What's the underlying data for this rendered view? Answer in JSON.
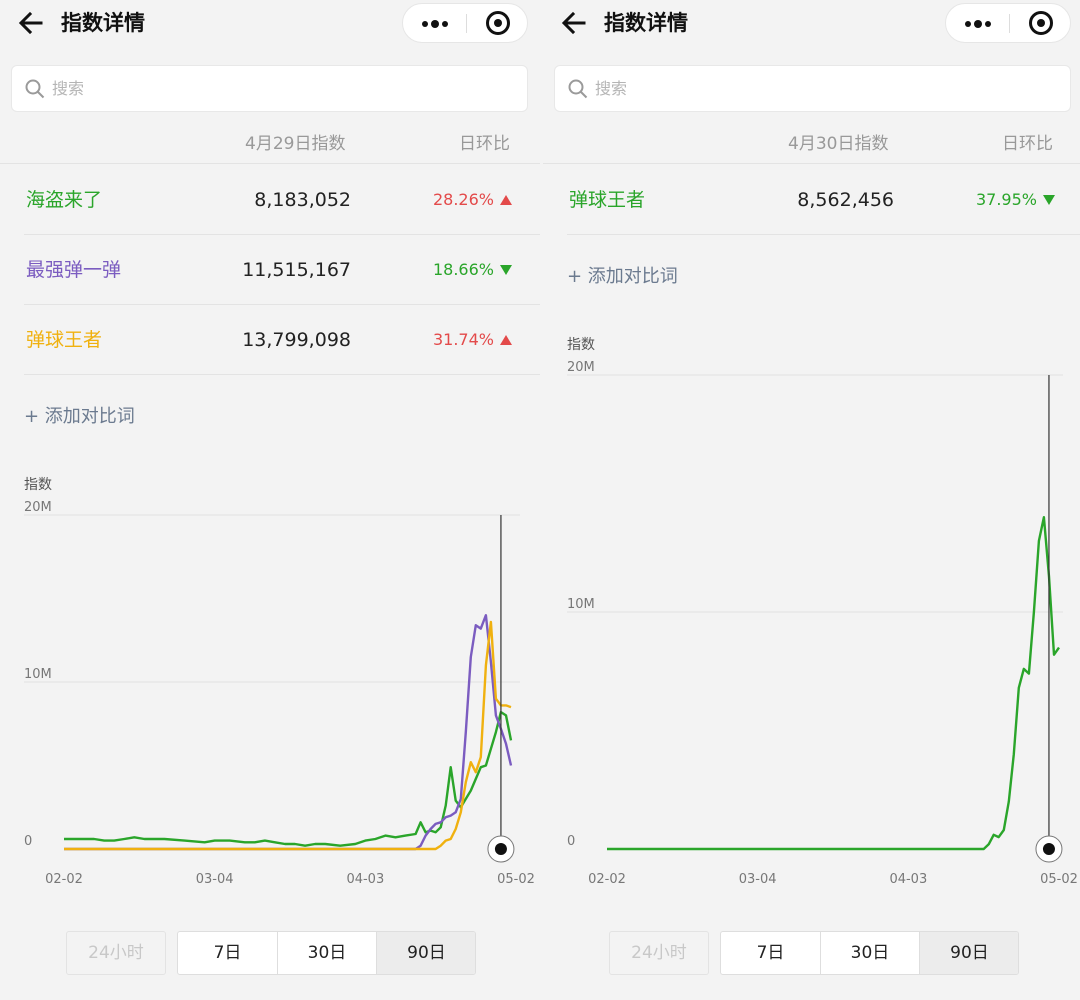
{
  "colors": {
    "green": "#2aa52a",
    "purple": "#7b5cc0",
    "orange": "#f0b10f",
    "up_red": "#e34a4a",
    "down_green": "#2aa52a",
    "grid": "#e2e2e2",
    "axis_text": "#777777"
  },
  "icons": [
    "arrow-left-icon",
    "more-dots-icon",
    "target-icon",
    "search-icon",
    "triangle-up-icon",
    "triangle-down-icon"
  ],
  "panels": [
    {
      "nav": {
        "title": "指数详情"
      },
      "search": {
        "placeholder": "搜索"
      },
      "table": {
        "date_header": "4月29日指数",
        "ratio_header": "日环比",
        "rows": [
          {
            "name": "海盗来了",
            "value": "8,183,052",
            "change": "28.26%",
            "direction": "up",
            "color": "#2aa52a"
          },
          {
            "name": "最强弹一弹",
            "value": "11,515,167",
            "change": "18.66%",
            "direction": "down",
            "color": "#7b5cc0"
          },
          {
            "name": "弹球王者",
            "value": "13,799,098",
            "change": "31.74%",
            "direction": "up",
            "color": "#f0b10f"
          }
        ]
      },
      "add_compare": "+ 添加对比词",
      "range_buttons": {
        "h24": "24小时",
        "d7": "7日",
        "d30": "30日",
        "d90": "90日",
        "selected": "90日",
        "h24_disabled": true
      }
    },
    {
      "nav": {
        "title": "指数详情"
      },
      "search": {
        "placeholder": "搜索"
      },
      "table": {
        "date_header": "4月30日指数",
        "ratio_header": "日环比",
        "rows": [
          {
            "name": "弹球王者",
            "value": "8,562,456",
            "change": "37.95%",
            "direction": "down",
            "color": "#2aa52a"
          }
        ]
      },
      "add_compare": "+ 添加对比词",
      "range_buttons": {
        "h24": "24小时",
        "d7": "7日",
        "d30": "30日",
        "d90": "90日",
        "selected": "90日",
        "h24_disabled": true
      }
    }
  ],
  "chart_data": [
    {
      "type": "line",
      "ylabel": "指数",
      "y_ticks": [
        "20M",
        "10M",
        "0"
      ],
      "ylim": [
        0,
        20000000
      ],
      "x_ticks": [
        "02-02",
        "03-04",
        "04-03",
        "05-02"
      ],
      "x_range_days": [
        0,
        90
      ],
      "cursor_day": 87,
      "grid": true,
      "series": [
        {
          "name": "海盗来了",
          "color": "#2aa52a",
          "points": [
            [
              0,
              0.6
            ],
            [
              6,
              0.6
            ],
            [
              8,
              0.5
            ],
            [
              10,
              0.5
            ],
            [
              12,
              0.6
            ],
            [
              14,
              0.7
            ],
            [
              16,
              0.6
            ],
            [
              20,
              0.6
            ],
            [
              24,
              0.5
            ],
            [
              28,
              0.4
            ],
            [
              30,
              0.5
            ],
            [
              33,
              0.5
            ],
            [
              36,
              0.4
            ],
            [
              38,
              0.4
            ],
            [
              40,
              0.5
            ],
            [
              42,
              0.4
            ],
            [
              44,
              0.3
            ],
            [
              46,
              0.3
            ],
            [
              48,
              0.2
            ],
            [
              50,
              0.3
            ],
            [
              52,
              0.3
            ],
            [
              55,
              0.2
            ],
            [
              58,
              0.3
            ],
            [
              60,
              0.5
            ],
            [
              62,
              0.6
            ],
            [
              64,
              0.8
            ],
            [
              66,
              0.7
            ],
            [
              68,
              0.8
            ],
            [
              70,
              0.9
            ],
            [
              71,
              1.6
            ],
            [
              72,
              1.0
            ],
            [
              73,
              1.1
            ],
            [
              74,
              1.0
            ],
            [
              75,
              1.3
            ],
            [
              76,
              2.6
            ],
            [
              77,
              4.9
            ],
            [
              78,
              2.9
            ],
            [
              79,
              2.5
            ],
            [
              80,
              3.0
            ],
            [
              81,
              3.5
            ],
            [
              82,
              4.2
            ],
            [
              83,
              4.9
            ],
            [
              84,
              5.0
            ],
            [
              85,
              6.0
            ],
            [
              86,
              7.0
            ],
            [
              87,
              8.2
            ],
            [
              88,
              8.0
            ],
            [
              89,
              6.5
            ]
          ]
        },
        {
          "name": "最强弹一弹",
          "color": "#7b5cc0",
          "points": [
            [
              0,
              0.0
            ],
            [
              70,
              0.0
            ],
            [
              71,
              0.2
            ],
            [
              72,
              0.8
            ],
            [
              73,
              1.2
            ],
            [
              74,
              1.5
            ],
            [
              75,
              1.6
            ],
            [
              76,
              1.9
            ],
            [
              77,
              2.0
            ],
            [
              78,
              2.2
            ],
            [
              79,
              3.0
            ],
            [
              80,
              7.0
            ],
            [
              81,
              11.5
            ],
            [
              82,
              13.4
            ],
            [
              83,
              13.2
            ],
            [
              84,
              14.0
            ],
            [
              85,
              11.2
            ],
            [
              86,
              8.0
            ],
            [
              87,
              7.2
            ],
            [
              88,
              6.3
            ],
            [
              89,
              5.0
            ]
          ]
        },
        {
          "name": "弹球王者",
          "color": "#f0b10f",
          "points": [
            [
              0,
              0.0
            ],
            [
              74,
              0.0
            ],
            [
              75,
              0.2
            ],
            [
              76,
              0.5
            ],
            [
              77,
              0.6
            ],
            [
              78,
              1.2
            ],
            [
              79,
              2.2
            ],
            [
              80,
              4.0
            ],
            [
              81,
              5.2
            ],
            [
              82,
              4.6
            ],
            [
              83,
              5.5
            ],
            [
              84,
              11.0
            ],
            [
              85,
              13.6
            ],
            [
              86,
              9.0
            ],
            [
              87,
              8.6
            ],
            [
              88,
              8.6
            ],
            [
              89,
              8.5
            ]
          ]
        }
      ]
    },
    {
      "type": "line",
      "ylabel": "指数",
      "y_ticks": [
        "20M",
        "10M",
        "0"
      ],
      "ylim": [
        0,
        20000000
      ],
      "x_ticks": [
        "02-02",
        "03-04",
        "04-03",
        "05-02"
      ],
      "x_range_days": [
        0,
        90
      ],
      "cursor_day": 88,
      "grid": true,
      "series": [
        {
          "name": "弹球王者",
          "color": "#2aa52a",
          "points": [
            [
              0,
              0.0
            ],
            [
              75,
              0.0
            ],
            [
              76,
              0.2
            ],
            [
              77,
              0.6
            ],
            [
              78,
              0.5
            ],
            [
              79,
              0.8
            ],
            [
              80,
              2.0
            ],
            [
              81,
              4.0
            ],
            [
              82,
              6.8
            ],
            [
              83,
              7.6
            ],
            [
              84,
              7.4
            ],
            [
              85,
              10.0
            ],
            [
              86,
              13.0
            ],
            [
              87,
              14.0
            ],
            [
              88,
              11.5
            ],
            [
              89,
              8.2
            ],
            [
              90,
              8.5
            ]
          ]
        }
      ]
    }
  ]
}
